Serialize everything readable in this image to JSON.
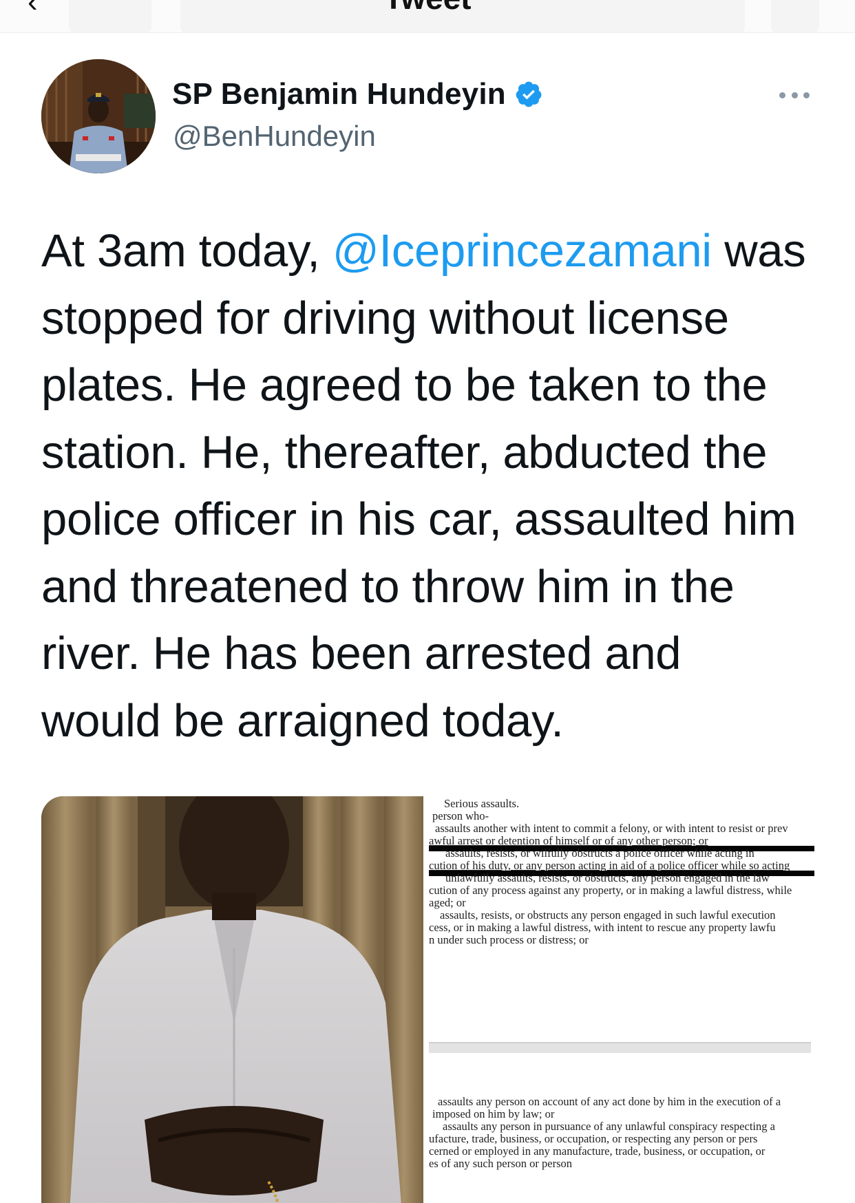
{
  "nav": {
    "back_glyph": "‹",
    "title": "Tweet"
  },
  "author": {
    "display_name": "SP Benjamin Hundeyin",
    "handle": "@BenHundeyin",
    "verified": true,
    "verified_color": "#1d9bf0"
  },
  "tweet": {
    "text_before": "At 3am today, ",
    "mention": "@Iceprincezamani",
    "text_after": " was stopped for driving without license plates. He agreed to be taken to the station. He, thereafter, abducted the police officer in his car, assaulted him and threatened to throw him in the river. He has been arrested and would be arraigned today.",
    "mention_color": "#1d9bf0"
  },
  "document": {
    "lines_top": [
      "Serious assaults.",
      "person who-",
      "assaults another with intent to commit a felony, or with intent to resist or prev",
      "awful arrest or detention of himself or of any other person; or",
      "assaults, resists, or wilfully obstructs a police officer while acting in",
      "cution of his duty, or any person acting in aid of a police officer while so acting",
      "unlawfully assaults, resists, or obstructs, any person engaged in the law",
      "cution of any process against any property, or in making a lawful distress, while",
      "aged; or",
      "assaults, resists, or obstructs any person engaged in such lawful execution",
      "cess, or in making a lawful distress, with intent to rescue any property lawfu",
      "n under such process or distress; or"
    ],
    "lines_bottom": [
      "assaults any person on account of any act done by him in the execution of a",
      "imposed on him by law; or",
      "assaults any person in pursuance of any unlawful conspiracy respecting a",
      "ufacture, trade, business, or occupation, or respecting any person or pers",
      "cerned or employed in any manufacture, trade, business, or occupation, or",
      "es of any such person or person"
    ]
  }
}
